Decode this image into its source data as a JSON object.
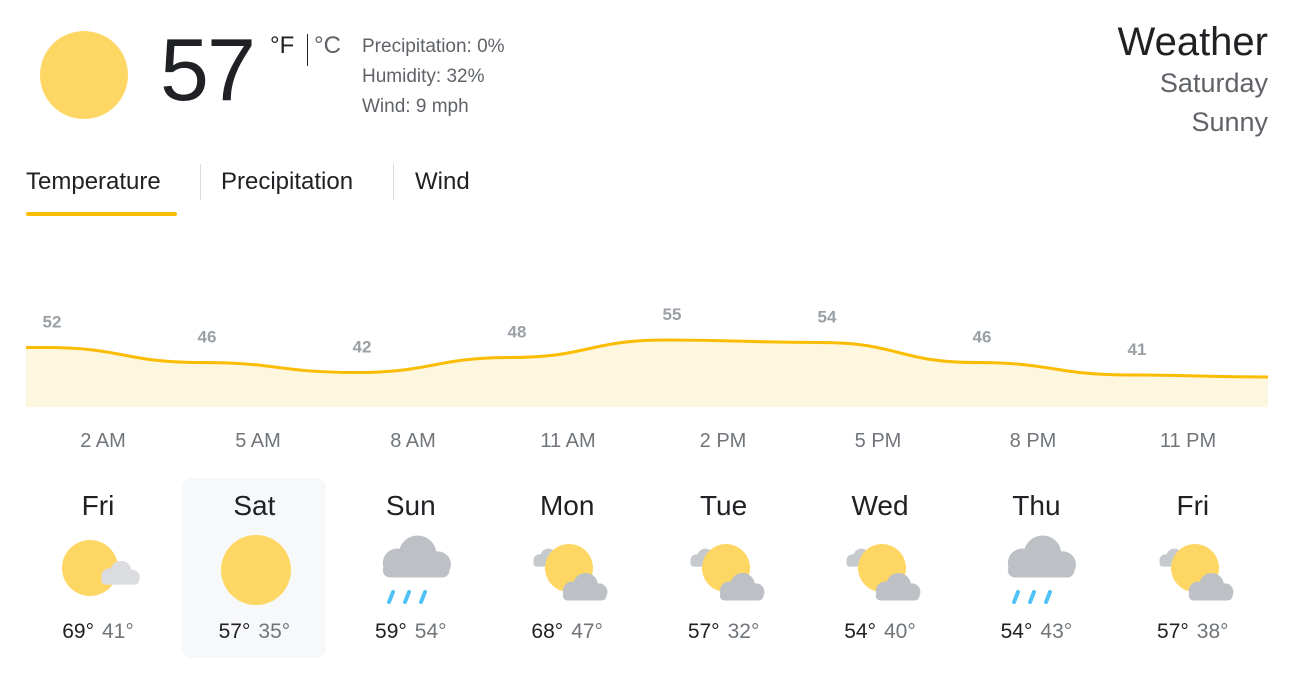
{
  "current": {
    "temperature": "57",
    "unit_f": "°F",
    "unit_c": "°C",
    "precipitation": "Precipitation: 0%",
    "humidity": "Humidity: 32%",
    "wind": "Wind: 9 mph",
    "icon": "sun-icon"
  },
  "header": {
    "title": "Weather",
    "day": "Saturday",
    "condition": "Sunny"
  },
  "tabs": [
    {
      "label": "Temperature",
      "active": true
    },
    {
      "label": "Precipitation",
      "active": false
    },
    {
      "label": "Wind",
      "active": false
    }
  ],
  "chart_data": {
    "type": "area",
    "x": [
      "2 AM",
      "5 AM",
      "8 AM",
      "11 AM",
      "2 PM",
      "5 PM",
      "8 PM",
      "11 PM"
    ],
    "values": [
      52,
      46,
      42,
      48,
      55,
      54,
      46,
      41
    ],
    "color": "#fbbc04",
    "fill": "#fef7e0"
  },
  "days": [
    {
      "name": "Fri",
      "high": "69°",
      "low": "41°",
      "icon": "partly-sunny-icon",
      "selected": false
    },
    {
      "name": "Sat",
      "high": "57°",
      "low": "35°",
      "icon": "sun-icon",
      "selected": true
    },
    {
      "name": "Sun",
      "high": "59°",
      "low": "54°",
      "icon": "rain-icon",
      "selected": false
    },
    {
      "name": "Mon",
      "high": "68°",
      "low": "47°",
      "icon": "partly-cloudy-icon",
      "selected": false
    },
    {
      "name": "Tue",
      "high": "57°",
      "low": "32°",
      "icon": "partly-cloudy-icon",
      "selected": false
    },
    {
      "name": "Wed",
      "high": "54°",
      "low": "40°",
      "icon": "partly-cloudy-icon",
      "selected": false
    },
    {
      "name": "Thu",
      "high": "54°",
      "low": "43°",
      "icon": "rain-icon",
      "selected": false
    },
    {
      "name": "Fri",
      "high": "57°",
      "low": "38°",
      "icon": "partly-cloudy-icon",
      "selected": false
    }
  ]
}
